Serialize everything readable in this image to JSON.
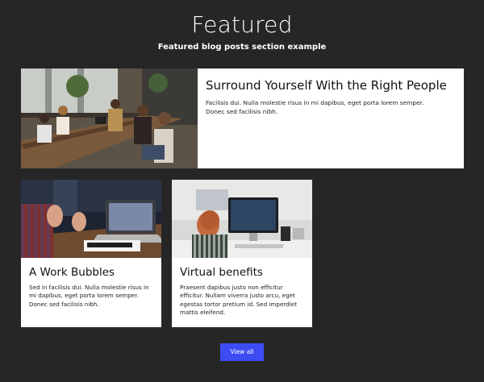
{
  "header": {
    "title": "Featured",
    "subtitle": "Featured blog posts section example"
  },
  "featured_post": {
    "title": "Surround Yourself With the Right People",
    "excerpt": "Facilisis dui. Nulla molestie risus in mi dapibus, eget porta lorem semper. Donec sed facilisis nibh."
  },
  "posts": [
    {
      "title": "A Work Bubbles",
      "excerpt": "Sed in facilisis dui. Nulla molestie risus in mi dapibus, eget porta lorem semper. Donec sed facilisis nibh."
    },
    {
      "title": "Virtual benefits",
      "excerpt": "Praesent dapibus justo non efficitur efficitur. Nullam viverra justo arcu, eget egestas tortor pretium id. Sed imperdiet mattis eleifend."
    }
  ],
  "actions": {
    "view_all_label": "View all"
  },
  "colors": {
    "background": "#262626",
    "card": "#ffffff",
    "button": "#3d4cf2"
  }
}
